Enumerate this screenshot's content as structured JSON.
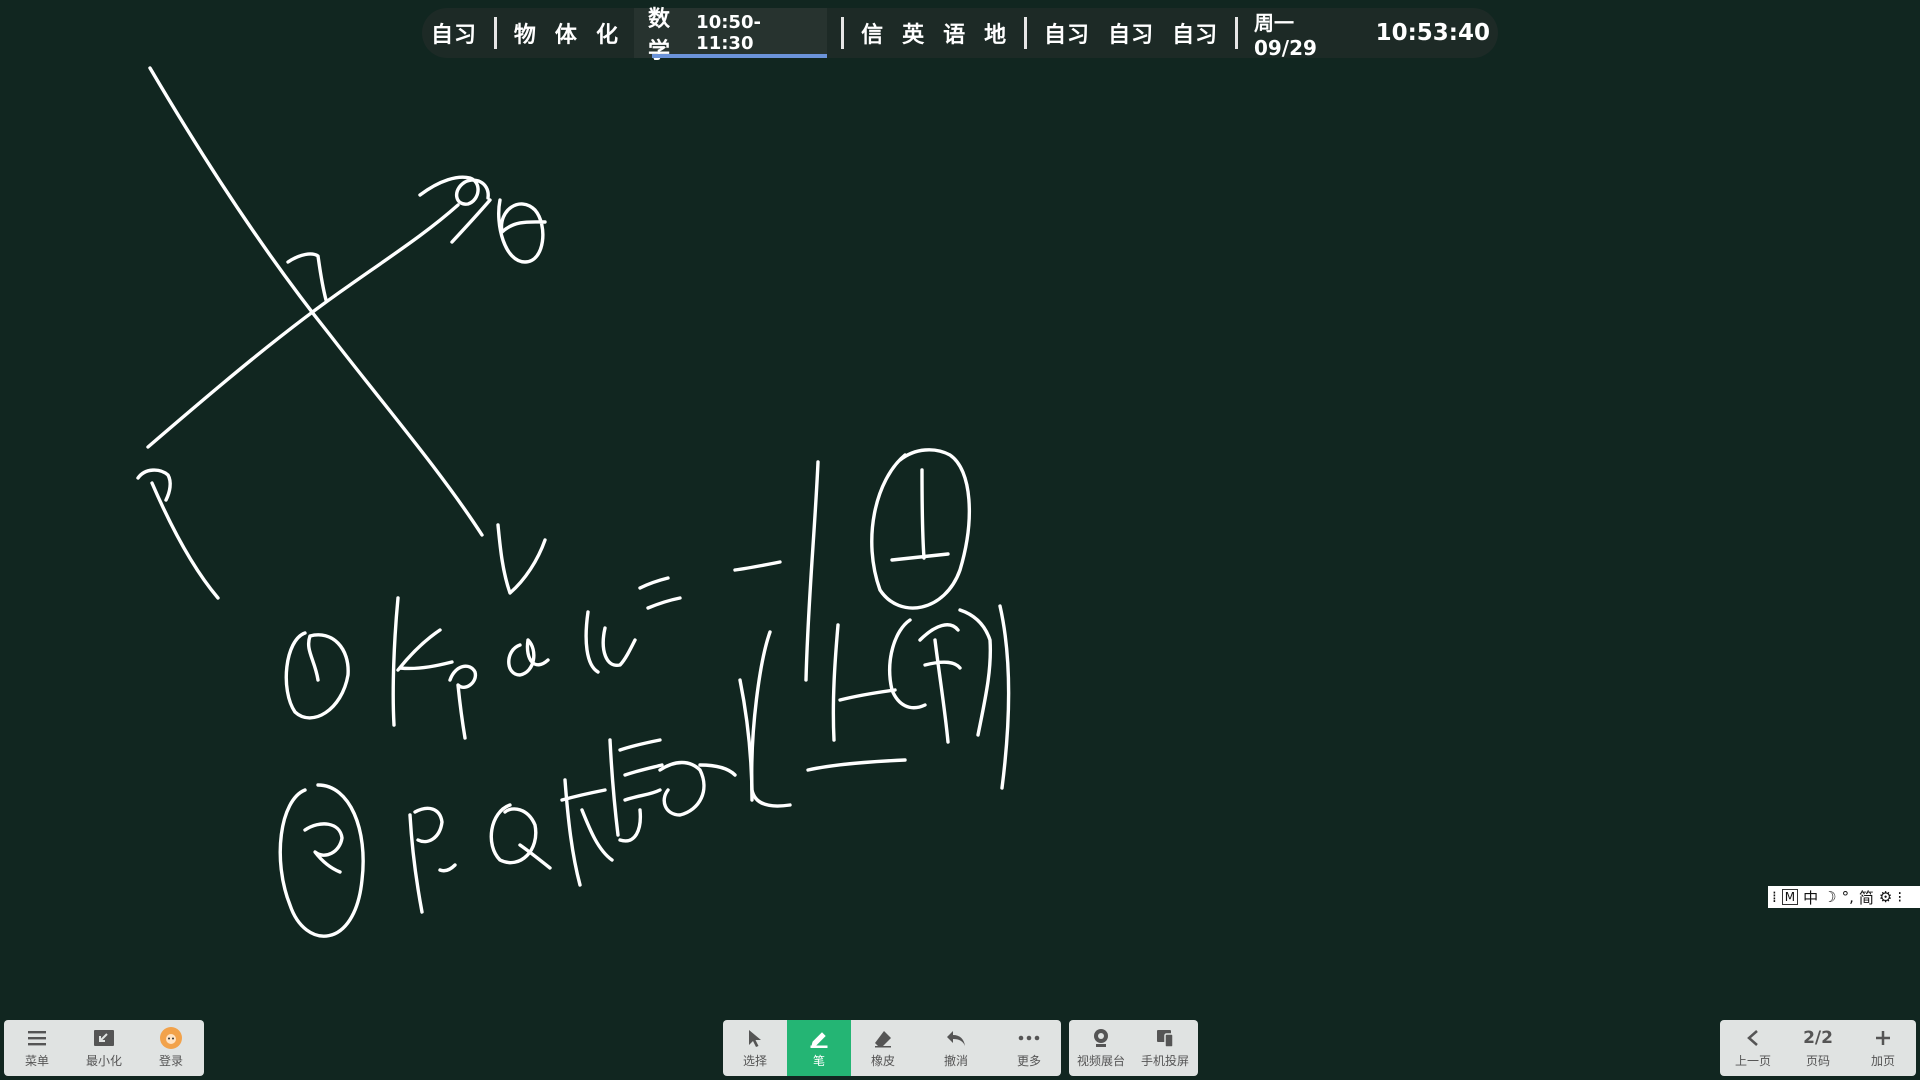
{
  "schedule": {
    "before_1": [
      "自习"
    ],
    "before_2": [
      "物",
      "体",
      "化"
    ],
    "current": {
      "subject": "数学",
      "time": "10:50-11:30"
    },
    "after_1": [
      "信",
      "英",
      "语",
      "地"
    ],
    "after_2": [
      "自习",
      "自习",
      "自习"
    ],
    "date": "周一 09/29",
    "clock": "10:53:40"
  },
  "ime": {
    "mode": "M",
    "lang": "中",
    "punct": "°,",
    "script": "简"
  },
  "left_toolbar": {
    "menu": "菜单",
    "minimize": "最小化",
    "login": "登录"
  },
  "center_toolbar": {
    "select": "选择",
    "pen": "笔",
    "eraser": "橡皮",
    "undo": "撤消",
    "more": "更多"
  },
  "extra_toolbar": {
    "visualizer": "视频展台",
    "phone_cast": "手机投屏"
  },
  "pager": {
    "prev": "上一页",
    "page": "2/2",
    "page_label": "页码",
    "add": "加页"
  },
  "colors": {
    "board": "#112620",
    "ink": "#ffffff",
    "active_tool": "#24b574",
    "current_class_bar": "#6b93d9"
  },
  "board": {
    "active_tool": "pen",
    "ink_color": "#ffffff"
  }
}
